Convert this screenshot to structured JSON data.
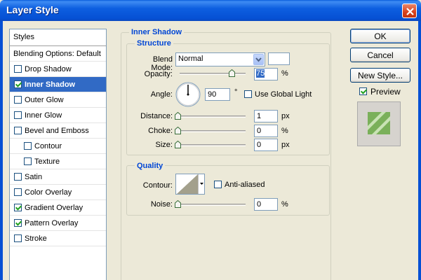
{
  "window": {
    "title": "Layer Style"
  },
  "styles": {
    "header": "Styles",
    "items": [
      {
        "label": "Blending Options: Default",
        "checkbox": false
      },
      {
        "label": "Drop Shadow",
        "checkbox": true,
        "checked": false
      },
      {
        "label": "Inner Shadow",
        "checkbox": true,
        "checked": true,
        "selected": true
      },
      {
        "label": "Outer Glow",
        "checkbox": true,
        "checked": false
      },
      {
        "label": "Inner Glow",
        "checkbox": true,
        "checked": false
      },
      {
        "label": "Bevel and Emboss",
        "checkbox": true,
        "checked": false
      },
      {
        "label": "Contour",
        "checkbox": true,
        "checked": false,
        "indent": true
      },
      {
        "label": "Texture",
        "checkbox": true,
        "checked": false,
        "indent": true
      },
      {
        "label": "Satin",
        "checkbox": true,
        "checked": false
      },
      {
        "label": "Color Overlay",
        "checkbox": true,
        "checked": false
      },
      {
        "label": "Gradient Overlay",
        "checkbox": true,
        "checked": true
      },
      {
        "label": "Pattern Overlay",
        "checkbox": true,
        "checked": true
      },
      {
        "label": "Stroke",
        "checkbox": true,
        "checked": false
      }
    ]
  },
  "inner_shadow": {
    "title": "Inner Shadow",
    "structure": {
      "title": "Structure",
      "blend_mode": {
        "label": "Blend Mode:",
        "value": "Normal"
      },
      "opacity": {
        "label": "Opacity:",
        "value": "75",
        "unit": "%",
        "level": 0.75
      },
      "angle": {
        "label": "Angle:",
        "value": "90",
        "unit": "°",
        "global_light_label": "Use Global Light",
        "global_light_checked": false
      },
      "distance": {
        "label": "Distance:",
        "value": "1",
        "unit": "px"
      },
      "choke": {
        "label": "Choke:",
        "value": "0",
        "unit": "%"
      },
      "size": {
        "label": "Size:",
        "value": "0",
        "unit": "px"
      }
    },
    "quality": {
      "title": "Quality",
      "contour": {
        "label": "Contour:"
      },
      "anti_aliased": {
        "label": "Anti-aliased",
        "checked": false
      },
      "noise": {
        "label": "Noise:",
        "value": "0",
        "unit": "%"
      }
    }
  },
  "buttons": {
    "ok": "OK",
    "cancel": "Cancel",
    "new_style": "New Style..."
  },
  "preview": {
    "label": "Preview",
    "checked": true
  },
  "colors": {
    "titlebar": "#0650d4",
    "selection": "#316ac5",
    "group_title": "#0046d5",
    "preview_stripe": "#7ab05a"
  }
}
